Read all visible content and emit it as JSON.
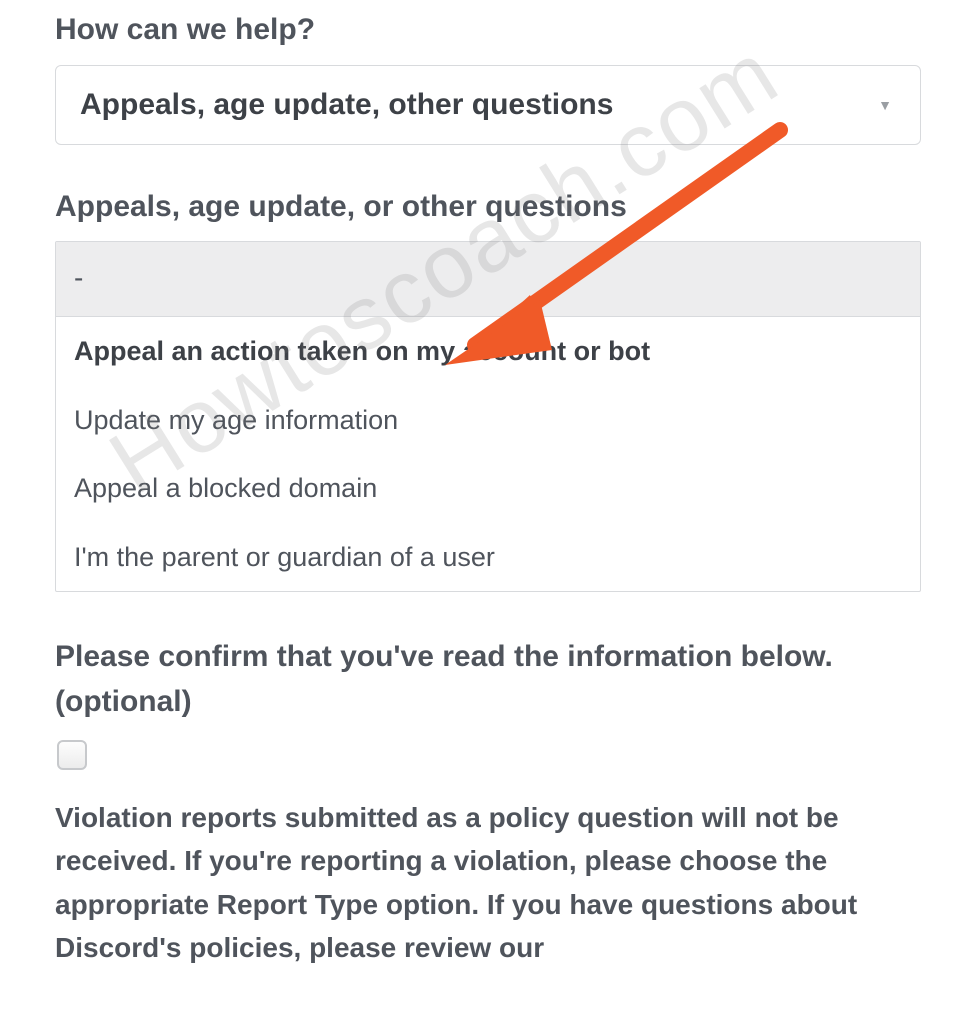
{
  "help": {
    "label": "How can we help?",
    "selected": "Appeals, age update, other questions"
  },
  "subcategory": {
    "label": "Appeals, age update, or other questions",
    "placeholder": "-",
    "options": [
      "Appeal an action taken on my account or bot",
      "Update my age information",
      "Appeal a blocked domain",
      "I'm the parent or guardian of a user"
    ],
    "highlightedIndex": 0
  },
  "confirm": {
    "label": "Please confirm that you've read the information below. (optional)",
    "checked": false
  },
  "infoText": "Violation reports submitted as a policy question will not be received. If you're reporting a violation, please choose the appropriate Report Type option. If you have questions about Discord's policies, please review our",
  "watermark": "Howtoscoach.com",
  "annotation": {
    "arrowColor": "#f05a28"
  }
}
